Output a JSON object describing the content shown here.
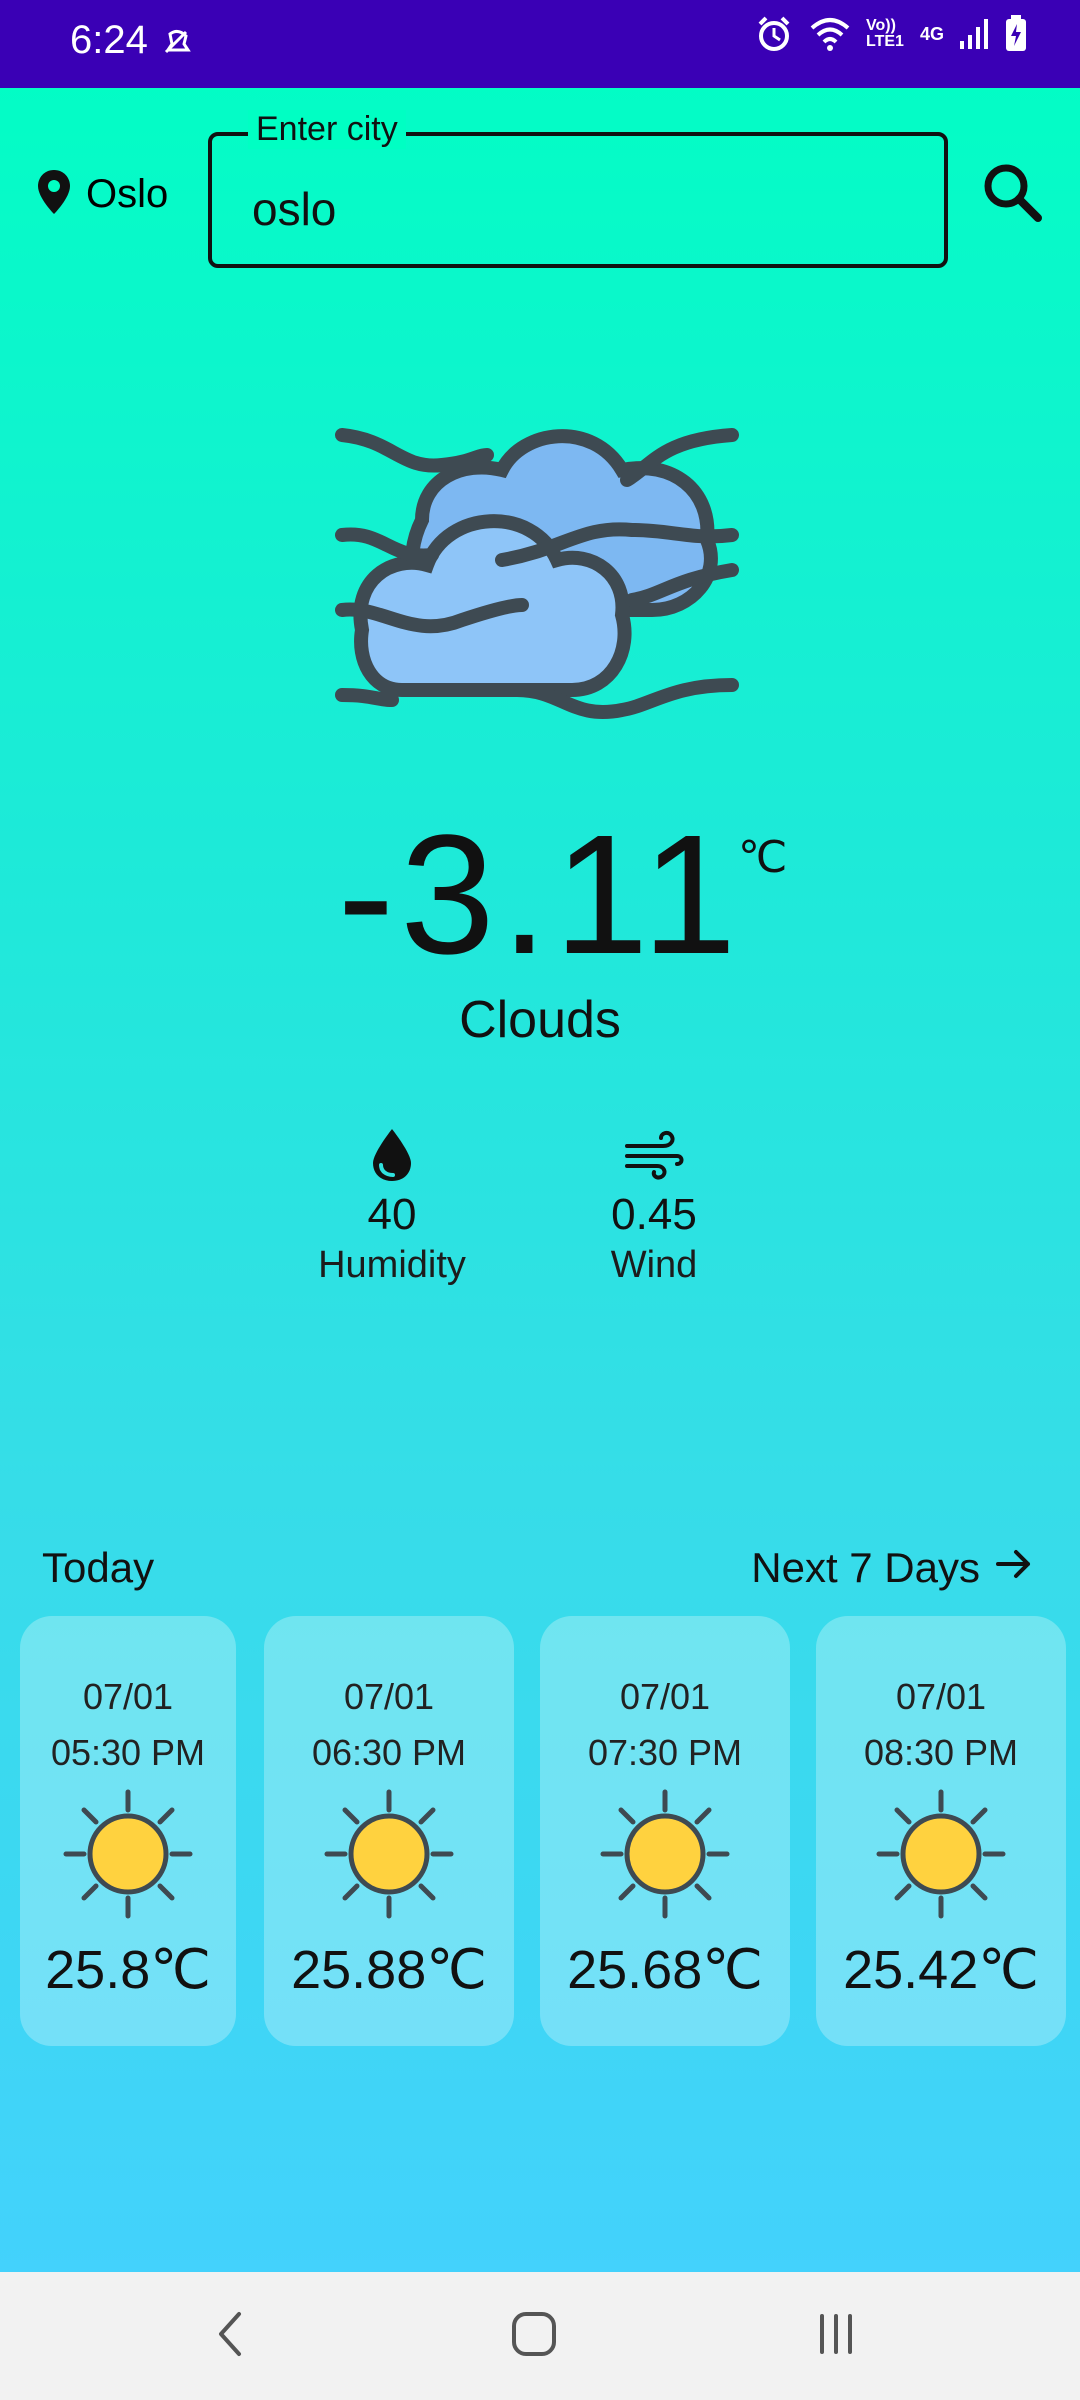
{
  "status_bar": {
    "time": "6:24",
    "network_label": "Vo)) LTE1",
    "network_type": "4G"
  },
  "header": {
    "location_name": "Oslo",
    "search_label": "Enter city",
    "search_value": "oslo"
  },
  "current": {
    "temperature": "-3.11",
    "unit": "℃",
    "condition": "Clouds",
    "humidity": {
      "value": "40",
      "label": "Humidity"
    },
    "wind": {
      "value": "0.45",
      "label": "Wind"
    }
  },
  "forecast": {
    "today_label": "Today",
    "next_label": "Next 7 Days",
    "cards": [
      {
        "date": "07/01",
        "time": "05:30 PM",
        "temp": "25.8℃",
        "icon": "sun-icon"
      },
      {
        "date": "07/01",
        "time": "06:30 PM",
        "temp": "25.88℃",
        "icon": "sun-icon"
      },
      {
        "date": "07/01",
        "time": "07:30 PM",
        "temp": "25.68℃",
        "icon": "sun-icon"
      },
      {
        "date": "07/01",
        "time": "08:30 PM",
        "temp": "25.42℃",
        "icon": "sun-icon"
      }
    ]
  },
  "colors": {
    "status_bar": "#3A00B5",
    "gradient_top": "#00FFC3",
    "gradient_bottom": "#45D0FF",
    "sun": "#FFD23F"
  }
}
